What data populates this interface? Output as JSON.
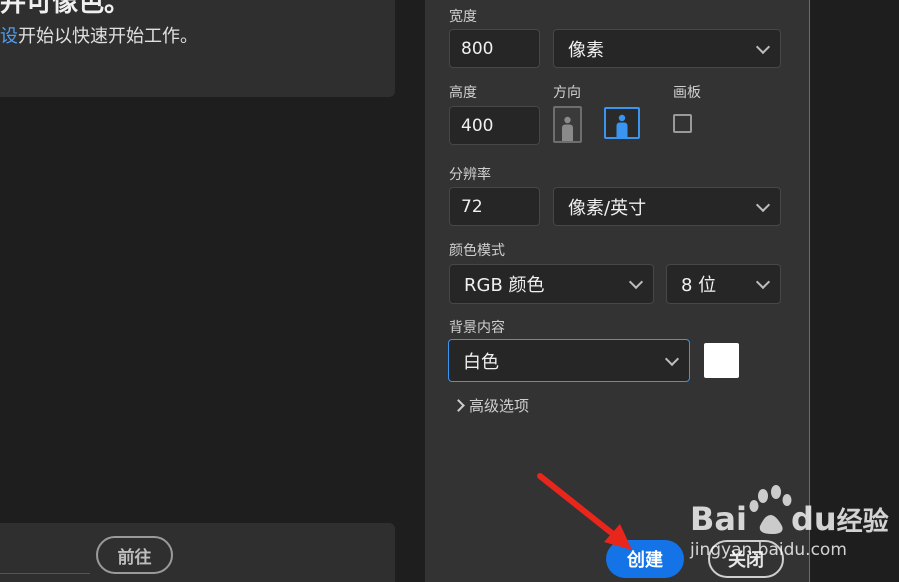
{
  "intro": {
    "title_fragment": "并可像色。",
    "sub_link": "设",
    "sub_text": "开始以快速开始工作。"
  },
  "left_bottom": {
    "goto_label": "前往"
  },
  "panel": {
    "width": {
      "label": "宽度",
      "value": "800",
      "unit": "像素"
    },
    "height": {
      "label": "高度",
      "value": "400"
    },
    "orientation": {
      "label": "方向",
      "selected": "landscape"
    },
    "artboard": {
      "label": "画板",
      "checked": false
    },
    "resolution": {
      "label": "分辨率",
      "value": "72",
      "unit": "像素/英寸"
    },
    "color_mode": {
      "label": "颜色模式",
      "mode": "RGB 颜色",
      "depth": "8 位"
    },
    "background": {
      "label": "背景内容",
      "value": "白色",
      "swatch_color": "#ffffff"
    },
    "advanced_label": "高级选项"
  },
  "actions": {
    "create_label": "创建",
    "close_label": "关闭"
  },
  "colors": {
    "accent": "#1473e6",
    "arrow": "#e8261c",
    "panel_bg": "#333333"
  },
  "watermark": {
    "brand_text": "Bai",
    "brand_text_2": "du",
    "brand_suffix": "经验",
    "url": "jingyan.baidu.com"
  }
}
